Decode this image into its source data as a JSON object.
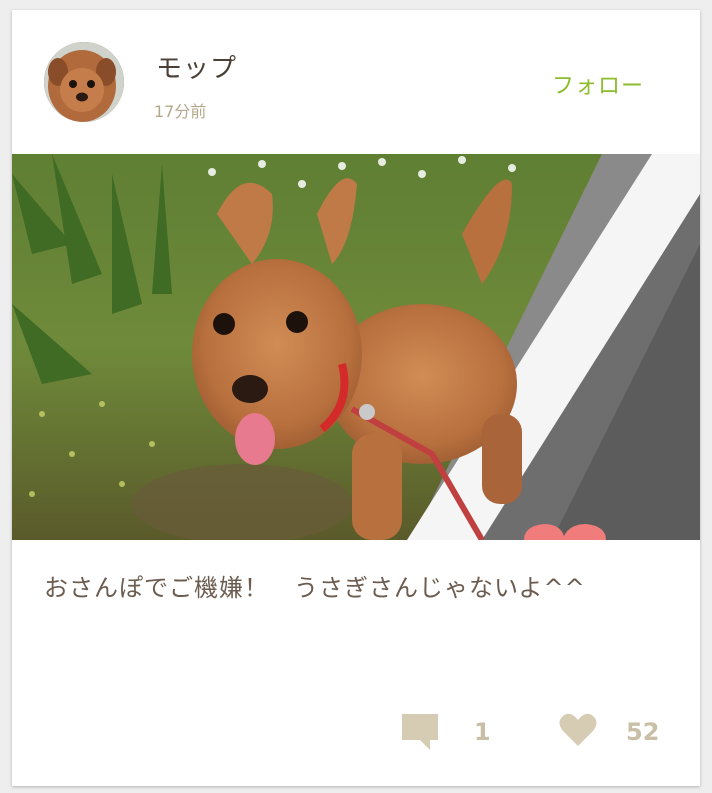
{
  "post": {
    "author": {
      "name": "モップ",
      "avatar_icon": "dog-avatar"
    },
    "time_ago": "17分前",
    "follow_label": "フォロー",
    "photo": {
      "subject": "poodle-dog-photo"
    },
    "caption": "おさんぽでご機嫌！　うさぎさんじゃないよ^^",
    "comments": {
      "icon": "comment-icon",
      "count": "1"
    },
    "likes": {
      "icon": "heart-icon",
      "count": "52"
    }
  },
  "colors": {
    "follow": "#8bbd2c",
    "text": "#4a4037",
    "muted": "#b5a88c",
    "icon": "#d6ccb4",
    "heart_overlay": "#f07c7c"
  }
}
